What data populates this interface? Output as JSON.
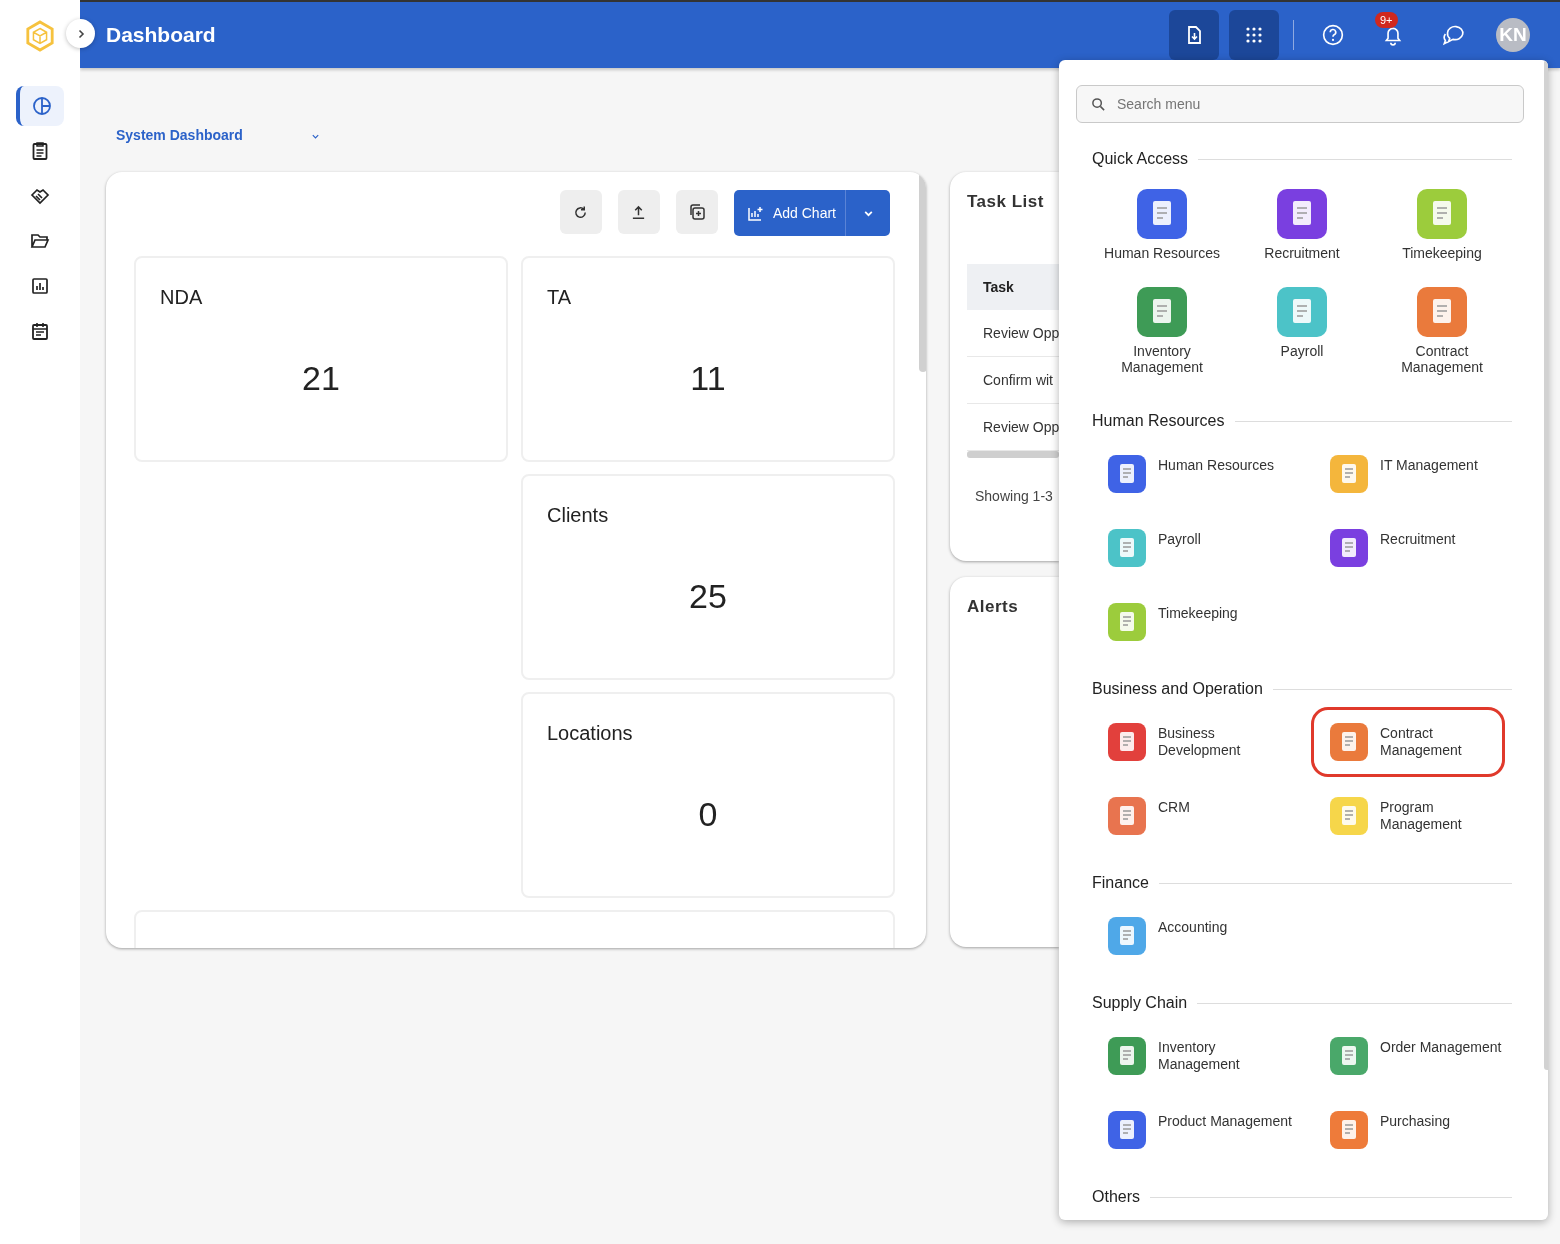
{
  "header": {
    "title": "Dashboard",
    "notification_badge": "9+",
    "avatar_initials": "KN"
  },
  "sidebar": {
    "items": [
      {
        "selected": true
      },
      {
        "selected": false
      },
      {
        "selected": false
      },
      {
        "selected": false
      },
      {
        "selected": false
      },
      {
        "selected": false
      }
    ]
  },
  "dashboard_selector": {
    "value": "System Dashboard"
  },
  "toolbar": {
    "add_chart": "Add Chart"
  },
  "stat_cards": [
    {
      "title": "NDA",
      "value": "21"
    },
    {
      "title": "TA",
      "value": "11"
    },
    {
      "title": "Clients",
      "value": "25"
    },
    {
      "title": "Locations",
      "value": "0"
    }
  ],
  "task_list": {
    "title": "Task List",
    "column": "Task",
    "rows": [
      "Review Opp",
      "Confirm wit",
      "Review Opp"
    ],
    "footer": "Showing 1-3"
  },
  "alerts": {
    "title": "Alerts"
  },
  "menu": {
    "search": {
      "placeholder": "Search menu"
    },
    "sections": [
      {
        "title": "Quick Access",
        "kind": "grid",
        "items": [
          {
            "label": "Human Resources",
            "color": "#3f63e6",
            "highlighted": false
          },
          {
            "label": "Recruitment",
            "color": "#7a3fe0",
            "highlighted": false
          },
          {
            "label": "Timekeeping",
            "color": "#9ccc3c",
            "highlighted": false
          },
          {
            "label": "Inventory Management",
            "color": "#3e9b56",
            "highlighted": false
          },
          {
            "label": "Payroll",
            "color": "#4cc3c8",
            "highlighted": false
          },
          {
            "label": "Contract Management",
            "color": "#ea7a3c",
            "highlighted": false
          }
        ]
      },
      {
        "title": "Human Resources",
        "kind": "list",
        "items": [
          {
            "label": "Human Resources",
            "color": "#3f63e6",
            "highlighted": false
          },
          {
            "label": "IT Management",
            "color": "#f4b63c",
            "highlighted": false
          },
          {
            "label": "Payroll",
            "color": "#4cc3c8",
            "highlighted": false
          },
          {
            "label": "Recruitment",
            "color": "#7a3fe0",
            "highlighted": false
          },
          {
            "label": "Timekeeping",
            "color": "#9ccc3c",
            "highlighted": false
          }
        ]
      },
      {
        "title": "Business and Operation",
        "kind": "list",
        "items": [
          {
            "label": "Business Development",
            "color": "#e2403c",
            "highlighted": false
          },
          {
            "label": "Contract Management",
            "color": "#ea7a3c",
            "highlighted": true
          },
          {
            "label": "CRM",
            "color": "#e8744f",
            "highlighted": false
          },
          {
            "label": "Program Management",
            "color": "#f6d64a",
            "highlighted": false
          }
        ]
      },
      {
        "title": "Finance",
        "kind": "list",
        "items": [
          {
            "label": "Accounting",
            "color": "#4fa8e8",
            "highlighted": false
          }
        ]
      },
      {
        "title": "Supply Chain",
        "kind": "list",
        "items": [
          {
            "label": "Inventory Management",
            "color": "#3e9b56",
            "highlighted": false
          },
          {
            "label": "Order Management",
            "color": "#4aa86a",
            "highlighted": false
          },
          {
            "label": "Product Management",
            "color": "#3f63e6",
            "highlighted": false
          },
          {
            "label": "Purchasing",
            "color": "#ee7b3a",
            "highlighted": false
          }
        ]
      },
      {
        "title": "Others",
        "kind": "list"
      }
    ]
  }
}
